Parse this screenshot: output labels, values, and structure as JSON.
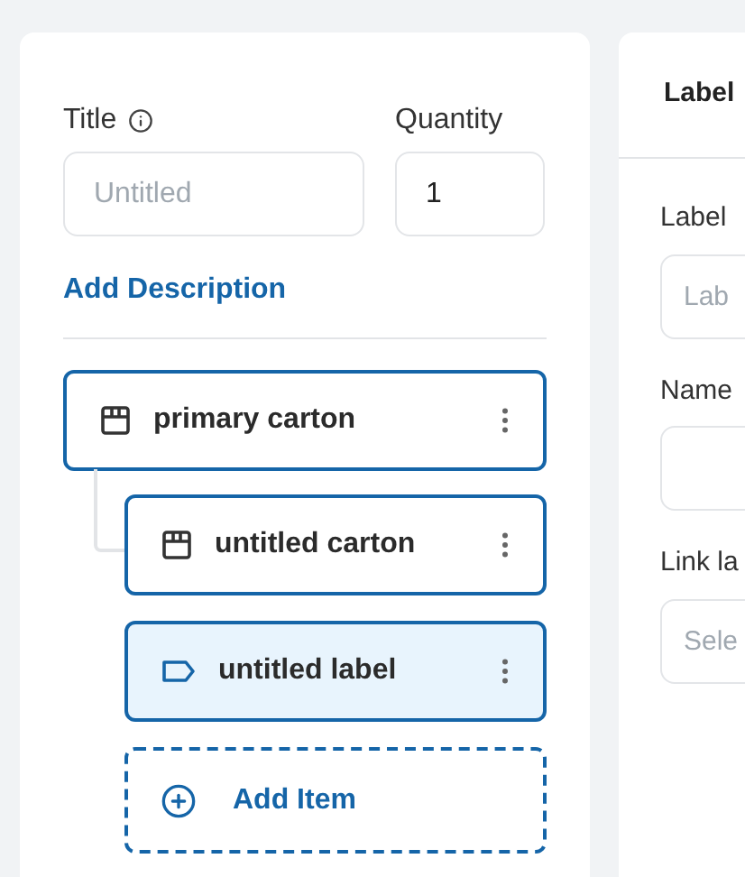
{
  "item_form": {
    "title_label": "Title",
    "title_placeholder": "Untitled",
    "quantity_label": "Quantity",
    "quantity_value": "1",
    "add_description": "Add Description"
  },
  "tree": [
    {
      "kind": "carton",
      "name": "primary carton",
      "selected": false,
      "children": [
        {
          "kind": "carton",
          "name": "untitled carton",
          "selected": false
        },
        {
          "kind": "label",
          "name": "untitled label",
          "selected": true
        }
      ]
    }
  ],
  "add_item": "Add Item",
  "detail_panel": {
    "header": "Label",
    "fields": [
      {
        "label": "Label",
        "placeholder": "Lab"
      },
      {
        "label": "Name"
      },
      {
        "label": "Link la",
        "placeholder": "Sele"
      }
    ]
  }
}
